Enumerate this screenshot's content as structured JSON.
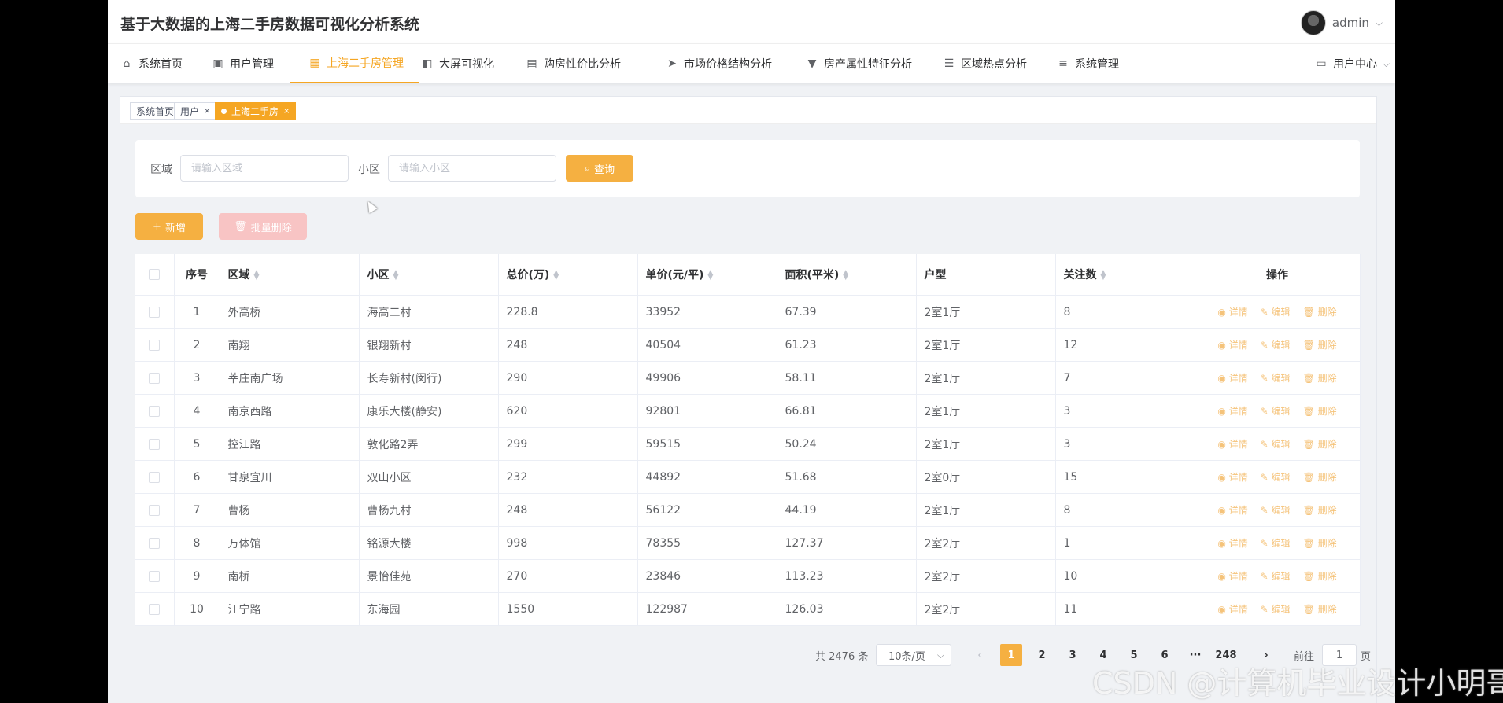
{
  "app": {
    "title": "基于大数据的上海二手房数据可视化分析系统",
    "user": "admin"
  },
  "nav": [
    {
      "label": "系统首页",
      "icon": "home-icon",
      "glyph": "⌂"
    },
    {
      "label": "用户管理",
      "icon": "chat-icon",
      "glyph": "▣"
    },
    {
      "label": "上海二手房管理",
      "icon": "grid-icon",
      "glyph": "▦",
      "active": true
    },
    {
      "label": "大屏可视化",
      "icon": "projector-icon",
      "glyph": "◧"
    },
    {
      "label": "购房性价比分析",
      "icon": "briefcase-icon",
      "glyph": "▤"
    },
    {
      "label": "市场价格结构分析",
      "icon": "send-icon",
      "glyph": "➤"
    },
    {
      "label": "房产属性特征分析",
      "icon": "brush-icon",
      "glyph": "▼"
    },
    {
      "label": "区域热点分析",
      "icon": "sliders-icon",
      "glyph": "☰"
    },
    {
      "label": "系统管理",
      "icon": "menu-icon",
      "glyph": "≡"
    }
  ],
  "user_center": "用户中心",
  "tags": [
    {
      "label": "系统首页"
    },
    {
      "label": "用户",
      "closable": true
    },
    {
      "label": "上海二手房",
      "closable": true,
      "active": true
    }
  ],
  "search": {
    "district_label": "区域",
    "district_placeholder": "请输入区域",
    "community_label": "小区",
    "community_placeholder": "请输入小区",
    "query_button": "查询"
  },
  "actions": {
    "add": "新增",
    "batch_delete": "批量删除"
  },
  "table": {
    "columns": [
      "序号",
      "区域",
      "小区",
      "总价(万)",
      "单价(元/平)",
      "面积(平米)",
      "户型",
      "关注数",
      "操作"
    ],
    "ops": [
      "详情",
      "编辑",
      "删除"
    ],
    "rows": [
      [
        "1",
        "外高桥",
        "海高二村",
        "228.8",
        "33952",
        "67.39",
        "2室1厅",
        "8"
      ],
      [
        "2",
        "南翔",
        "银翔新村",
        "248",
        "40504",
        "61.23",
        "2室1厅",
        "12"
      ],
      [
        "3",
        "莘庄南广场",
        "长寿新村(闵行)",
        "290",
        "49906",
        "58.11",
        "2室1厅",
        "7"
      ],
      [
        "4",
        "南京西路",
        "康乐大楼(静安)",
        "620",
        "92801",
        "66.81",
        "2室1厅",
        "3"
      ],
      [
        "5",
        "控江路",
        "敦化路2弄",
        "299",
        "59515",
        "50.24",
        "2室1厅",
        "3"
      ],
      [
        "6",
        "甘泉宜川",
        "双山小区",
        "232",
        "44892",
        "51.68",
        "2室0厅",
        "15"
      ],
      [
        "7",
        "曹杨",
        "曹杨九村",
        "248",
        "56122",
        "44.19",
        "2室1厅",
        "8"
      ],
      [
        "8",
        "万体馆",
        "铭源大楼",
        "998",
        "78355",
        "127.37",
        "2室2厅",
        "1"
      ],
      [
        "9",
        "南桥",
        "景怡佳苑",
        "270",
        "23846",
        "113.23",
        "2室2厅",
        "10"
      ],
      [
        "10",
        "江宁路",
        "东海园",
        "1550",
        "122987",
        "126.03",
        "2室2厅",
        "11"
      ]
    ]
  },
  "pagination": {
    "total": "共 2476 条",
    "page_size": "10条/页",
    "pages": [
      "1",
      "2",
      "3",
      "4",
      "5",
      "6",
      "···",
      "248"
    ],
    "current": "1",
    "goto_label": "前往",
    "goto_value": "1",
    "page_suffix": "页"
  },
  "watermark": "CSDN @计算机毕业设计小明哥",
  "colors": {
    "accent": "#f5a623",
    "danger_light": "#f8c4c4"
  }
}
